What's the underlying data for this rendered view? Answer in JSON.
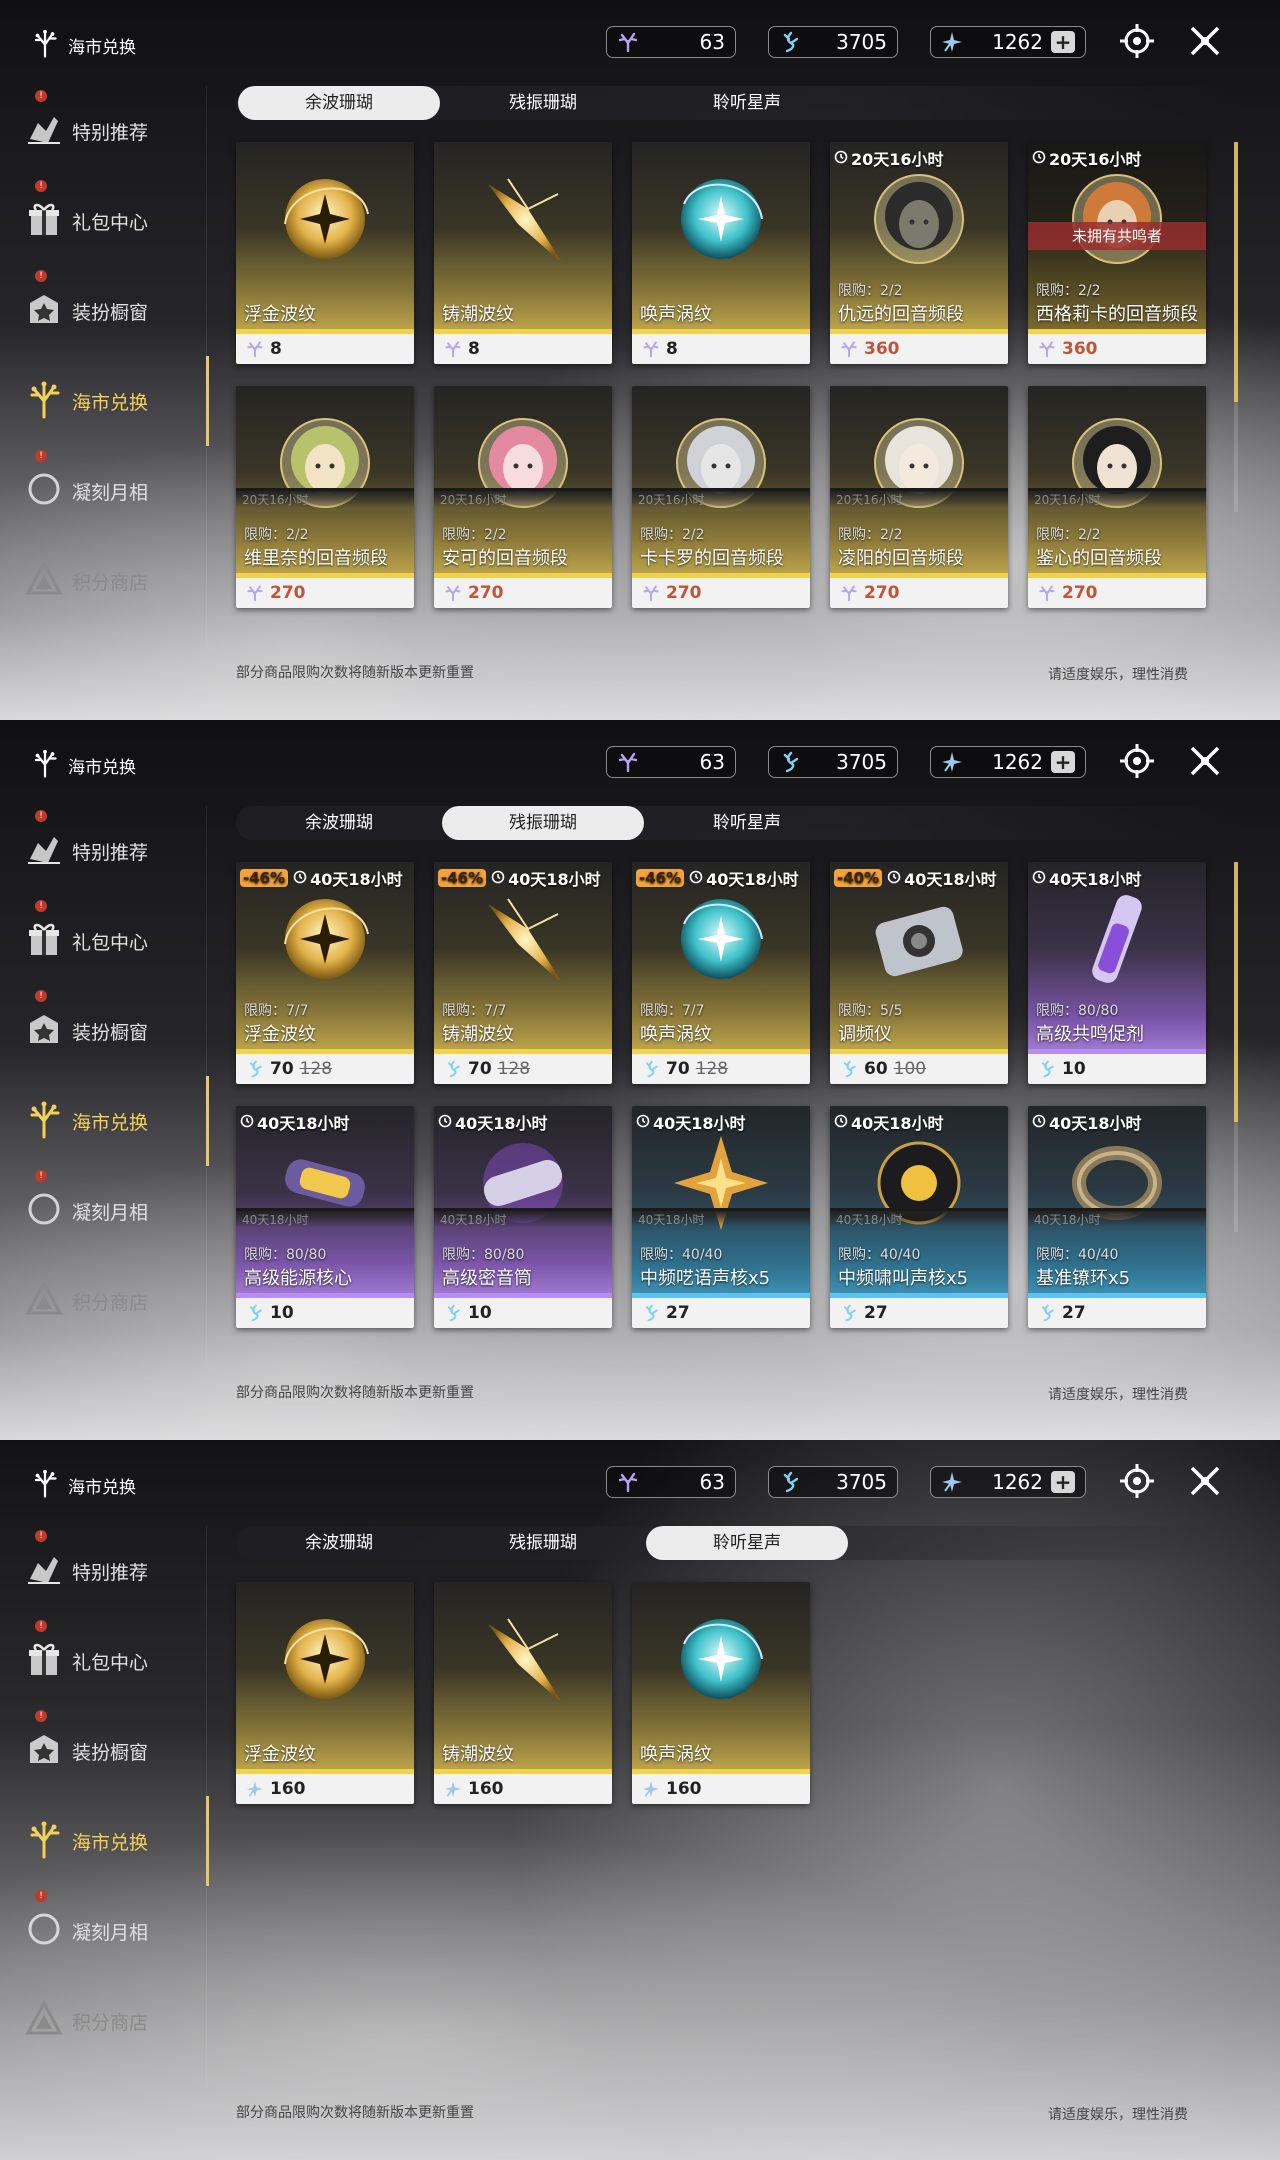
{
  "colors": {
    "accent": "#f2d05a",
    "gold_bar": "#f2d24c",
    "purple_bar": "#b98df0",
    "blue_bar": "#5ec3ee",
    "red_price": "#c0553a",
    "discount": "#f4a33b",
    "unowned_banner": "#962e2e"
  },
  "header": {
    "title": "海市兑换",
    "currency1": "63",
    "currency2": "3705",
    "currency3": "1262",
    "plus": "+"
  },
  "sidebar": [
    {
      "label": "特别推荐",
      "icon": "featured-icon",
      "badge": "!"
    },
    {
      "label": "礼包中心",
      "icon": "gift-icon",
      "badge": "!"
    },
    {
      "label": "装扮橱窗",
      "icon": "wardrobe-icon",
      "badge": "!"
    },
    {
      "label": "海市兑换",
      "icon": "coral-icon",
      "active": true
    },
    {
      "label": "凝刻月相",
      "icon": "moon-icon",
      "badge": "!"
    },
    {
      "label": "积分商店",
      "icon": "points-icon",
      "dim": true
    }
  ],
  "tabs": [
    "余波珊瑚",
    "残振珊瑚",
    "聆听星声"
  ],
  "footer": {
    "note": "部分商品限购次数将随新版本更新重置",
    "advice": "请适度娱乐，理性消费"
  },
  "panels": [
    {
      "selected_tab": 0,
      "cards": [
        {
          "name": "浮金波纹",
          "price": "8",
          "theme": "gold",
          "art": "golden-orb"
        },
        {
          "name": "铸潮波纹",
          "price": "8",
          "theme": "gold",
          "art": "golden-blade"
        },
        {
          "name": "唤声涡纹",
          "price": "8",
          "theme": "gold",
          "art": "teal-orb"
        },
        {
          "name": "仇远的回音频段",
          "price": "360",
          "price_red": true,
          "limit": "限购：2/2",
          "timer": "20天16小时",
          "theme": "gold",
          "art": "portrait-dark"
        },
        {
          "name": "西格莉卡的回音频段",
          "price": "360",
          "price_red": true,
          "limit": "限购：2/2",
          "timer": "20天16小时",
          "theme": "gold",
          "art": "portrait-orange",
          "banner": "未拥有共鸣者",
          "dimmed": true
        },
        {
          "name": "维里奈的回音频段",
          "price": "270",
          "price_red": true,
          "limit": "限购：2/2",
          "theme": "gold",
          "art": "portrait-green"
        },
        {
          "name": "安可的回音频段",
          "price": "270",
          "price_red": true,
          "limit": "限购：2/2",
          "theme": "gold",
          "art": "portrait-pink"
        },
        {
          "name": "卡卡罗的回音频段",
          "price": "270",
          "price_red": true,
          "limit": "限购：2/2",
          "theme": "gold",
          "art": "portrait-silver"
        },
        {
          "name": "凌阳的回音频段",
          "price": "270",
          "price_red": true,
          "limit": "限购：2/2",
          "theme": "gold",
          "art": "portrait-white"
        },
        {
          "name": "鉴心的回音频段",
          "price": "270",
          "price_red": true,
          "limit": "限购：2/2",
          "theme": "gold",
          "art": "portrait-black"
        }
      ],
      "stubs": 5,
      "stub_text": "20天16小时"
    },
    {
      "selected_tab": 1,
      "cards": [
        {
          "name": "浮金波纹",
          "price": "70",
          "old_price": "128",
          "limit": "限购：7/7",
          "timer": "40天18小时",
          "discount": "-46%",
          "theme": "gold",
          "art": "golden-orb"
        },
        {
          "name": "铸潮波纹",
          "price": "70",
          "old_price": "128",
          "limit": "限购：7/7",
          "timer": "40天18小时",
          "discount": "-46%",
          "theme": "gold",
          "art": "golden-blade"
        },
        {
          "name": "唤声涡纹",
          "price": "70",
          "old_price": "128",
          "limit": "限购：7/7",
          "timer": "40天18小时",
          "discount": "-46%",
          "theme": "gold",
          "art": "teal-orb"
        },
        {
          "name": "调频仪",
          "price": "60",
          "old_price": "100",
          "limit": "限购：5/5",
          "timer": "40天18小时",
          "discount": "-40%",
          "theme": "gold",
          "art": "tuner-device"
        },
        {
          "name": "高级共鸣促剂",
          "price": "10",
          "limit": "限购：80/80",
          "timer": "40天18小时",
          "theme": "purple",
          "art": "vial"
        },
        {
          "name": "高级能源核心",
          "price": "10",
          "limit": "限购：80/80",
          "timer": "40天18小时",
          "theme": "purple",
          "art": "energy-core"
        },
        {
          "name": "高级密音筒",
          "price": "10",
          "limit": "限购：80/80",
          "timer": "40天18小时",
          "theme": "purple",
          "art": "sealed-tube"
        },
        {
          "name": "中频呓语声核x5",
          "price": "27",
          "limit": "限购：40/40",
          "timer": "40天18小时",
          "theme": "blue",
          "art": "star-core"
        },
        {
          "name": "中频啸叫声核x5",
          "price": "27",
          "limit": "限购：40/40",
          "timer": "40天18小时",
          "theme": "blue",
          "art": "orb-core"
        },
        {
          "name": "基准镣环x5",
          "price": "27",
          "limit": "限购：40/40",
          "timer": "40天18小时",
          "theme": "blue",
          "art": "ring"
        }
      ],
      "stubs": 5,
      "stub_text": "40天18小时"
    },
    {
      "selected_tab": 2,
      "cards": [
        {
          "name": "浮金波纹",
          "price": "160",
          "theme": "gold",
          "art": "golden-orb",
          "currency": "star"
        },
        {
          "name": "铸潮波纹",
          "price": "160",
          "theme": "gold",
          "art": "golden-blade",
          "currency": "star"
        },
        {
          "name": "唤声涡纹",
          "price": "160",
          "theme": "gold",
          "art": "teal-orb",
          "currency": "star"
        }
      ],
      "stubs": 0
    }
  ]
}
